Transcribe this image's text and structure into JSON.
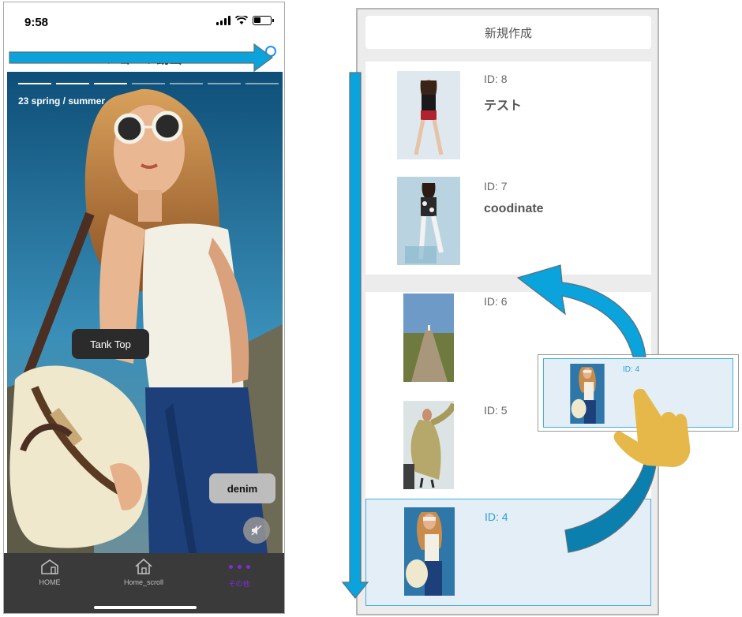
{
  "status": {
    "time": "9:58"
  },
  "nav": {
    "title": "ショート動画"
  },
  "photo": {
    "season": "23 spring / summer",
    "progress_total": 7,
    "progress_done": 3
  },
  "tags": {
    "tank_top": "Tank Top",
    "denim": "denim"
  },
  "tabbar": {
    "home": "HOME",
    "home_scroll": "Home_scroll",
    "other": "その他"
  },
  "list": {
    "new_button": "新規作成",
    "items": [
      {
        "id": "ID: 8",
        "title": "テスト"
      },
      {
        "id": "ID: 7",
        "title": "coodinate"
      },
      {
        "id": "ID: 6",
        "title": ""
      },
      {
        "id": "ID: 5",
        "title": ""
      },
      {
        "id": "ID: 4",
        "title": ""
      }
    ],
    "dragging": {
      "id": "ID: 4"
    }
  },
  "colors": {
    "accent_blue": "#0aa3dc",
    "active_tab": "#7b2fd6",
    "highlight_bg": "#e4eef6",
    "hand": "#e6b84a"
  }
}
